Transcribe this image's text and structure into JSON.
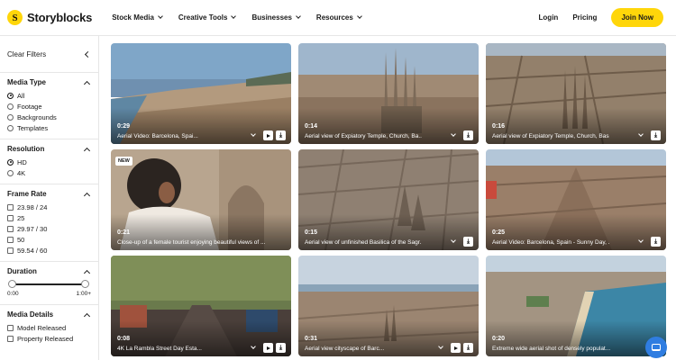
{
  "header": {
    "brand": "Storyblocks",
    "logo_letter": "S",
    "nav": [
      "Stock Media",
      "Creative Tools",
      "Businesses",
      "Resources"
    ],
    "login": "Login",
    "pricing": "Pricing",
    "join": "Join Now",
    "accent": "#ffd60a"
  },
  "sidebar": {
    "clear_filters": "Clear Filters",
    "media_type": {
      "title": "Media Type",
      "options": [
        "All",
        "Footage",
        "Backgrounds",
        "Templates"
      ],
      "selected": "All"
    },
    "resolution": {
      "title": "Resolution",
      "options": [
        "HD",
        "4K"
      ],
      "selected": "HD"
    },
    "frame_rate": {
      "title": "Frame Rate",
      "options": [
        "23.98 / 24",
        "25",
        "29.97 / 30",
        "50",
        "59.54 / 60"
      ]
    },
    "duration": {
      "title": "Duration",
      "min_label": "0:00",
      "max_label": "1:00+"
    },
    "media_details": {
      "title": "Media Details",
      "options": [
        "Model Released",
        "Property Released"
      ]
    }
  },
  "results": [
    {
      "duration": "0:29",
      "title": "Aerial Video: Barcelona, Spai...",
      "badge": ""
    },
    {
      "duration": "0:14",
      "title": "Aerial view of Expiatory Temple, Church, Ba...",
      "badge": ""
    },
    {
      "duration": "0:16",
      "title": "Aerial view of Expiatory Temple, Church, Bas...",
      "badge": ""
    },
    {
      "duration": "0:21",
      "title": "Close-up of a female tourist enjoying beautiful views of ...",
      "badge": "NEW"
    },
    {
      "duration": "0:15",
      "title": "Aerial view of unfinished Basilica of the Sagr...",
      "badge": ""
    },
    {
      "duration": "0:25",
      "title": "Aerial Video: Barcelona, Spain - Sunny Day, ...",
      "badge": ""
    },
    {
      "duration": "0:08",
      "title": "4K La Rambla Street Day Esta...",
      "badge": ""
    },
    {
      "duration": "0:31",
      "title": "Aerial view cityscape of Barc...",
      "badge": ""
    },
    {
      "duration": "0:20",
      "title": "Extreme wide aerial shot of densely populat...",
      "badge": ""
    }
  ],
  "support_chat_icon": "chat-bubble-icon"
}
